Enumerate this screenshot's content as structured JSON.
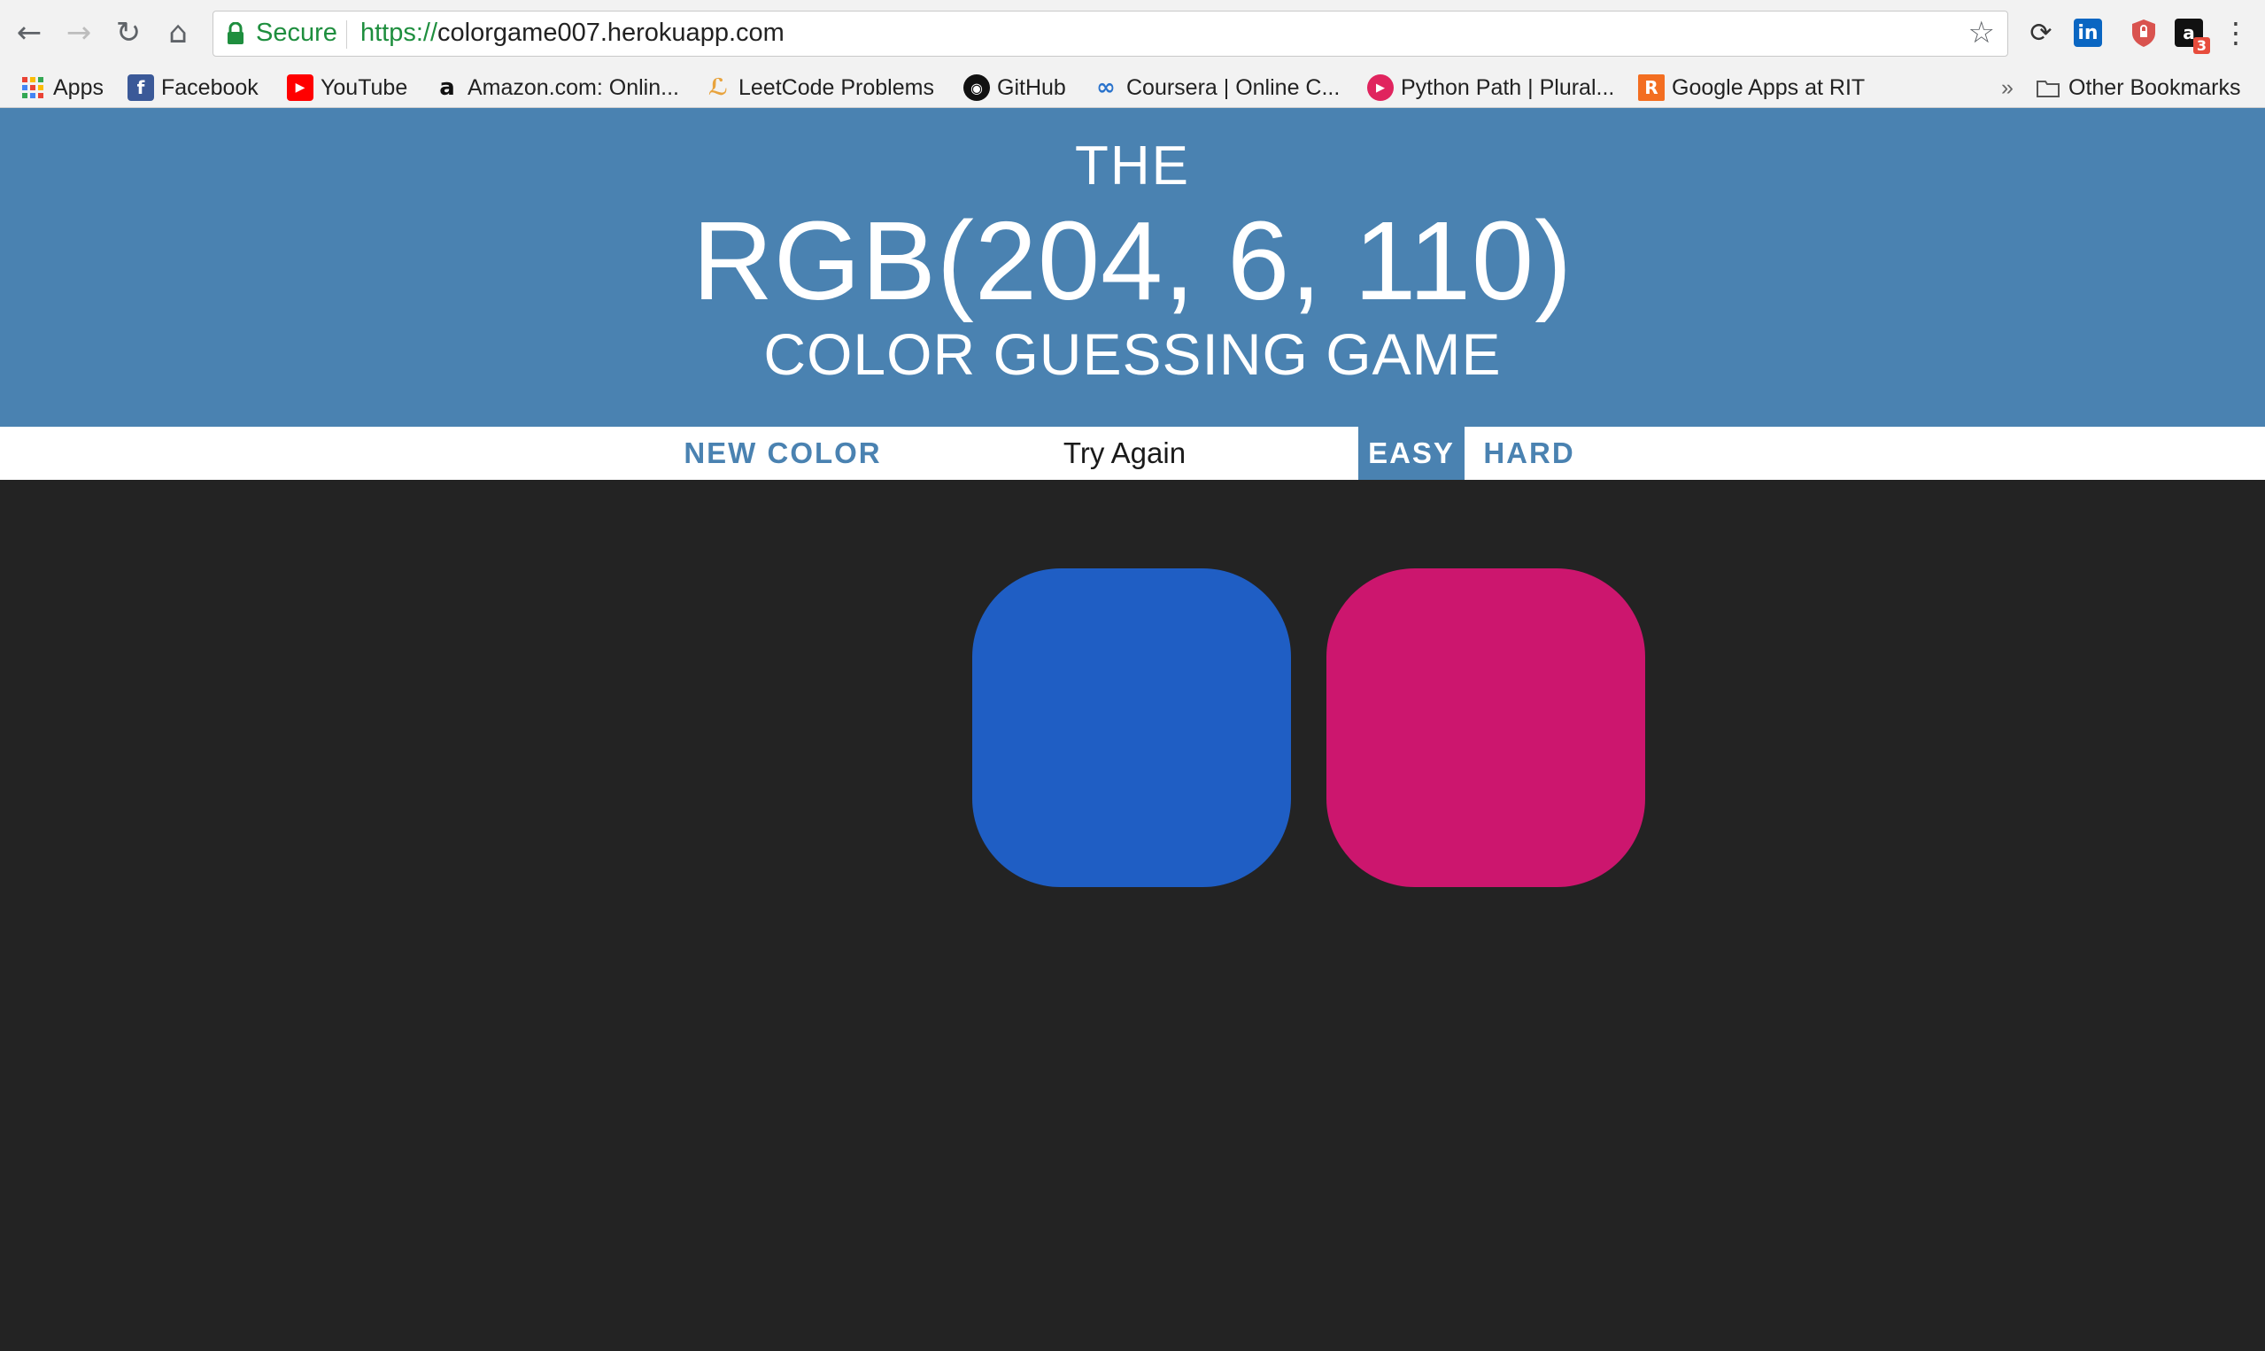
{
  "browser": {
    "secure_label": "Secure",
    "url_scheme": "https://",
    "url_rest": "colorgame007.herokuapp.com",
    "extension_badge": "3",
    "bookmarks": [
      {
        "label": "Apps",
        "icon": "apps-grid-icon"
      },
      {
        "label": "Facebook",
        "icon": "facebook-icon"
      },
      {
        "label": "YouTube",
        "icon": "youtube-icon"
      },
      {
        "label": "Amazon.com: Onlin...",
        "icon": "amazon-icon"
      },
      {
        "label": "LeetCode Problems",
        "icon": "leetcode-icon"
      },
      {
        "label": "GitHub",
        "icon": "github-icon"
      },
      {
        "label": "Coursera | Online C...",
        "icon": "coursera-icon"
      },
      {
        "label": "Python Path | Plural...",
        "icon": "pluralsight-icon"
      },
      {
        "label": "Google Apps at RIT",
        "icon": "rit-icon"
      }
    ],
    "overflow_label": "»",
    "other_bookmarks": "Other Bookmarks"
  },
  "header": {
    "line1": "THE",
    "rgb": "RGB(204, 6, 110)",
    "line3": "COLOR GUESSING GAME",
    "bg_color": "#4a82b1"
  },
  "controls": {
    "new_color": "NEW COLOR",
    "message": "Try Again",
    "easy": "EASY",
    "hard": "HARD",
    "active_mode": "EASY"
  },
  "squares": [
    {
      "color": "#1f5ec4"
    },
    {
      "color": "#cc166e"
    }
  ],
  "colors": {
    "page_bg": "#232323",
    "accent": "#4a82b1"
  }
}
